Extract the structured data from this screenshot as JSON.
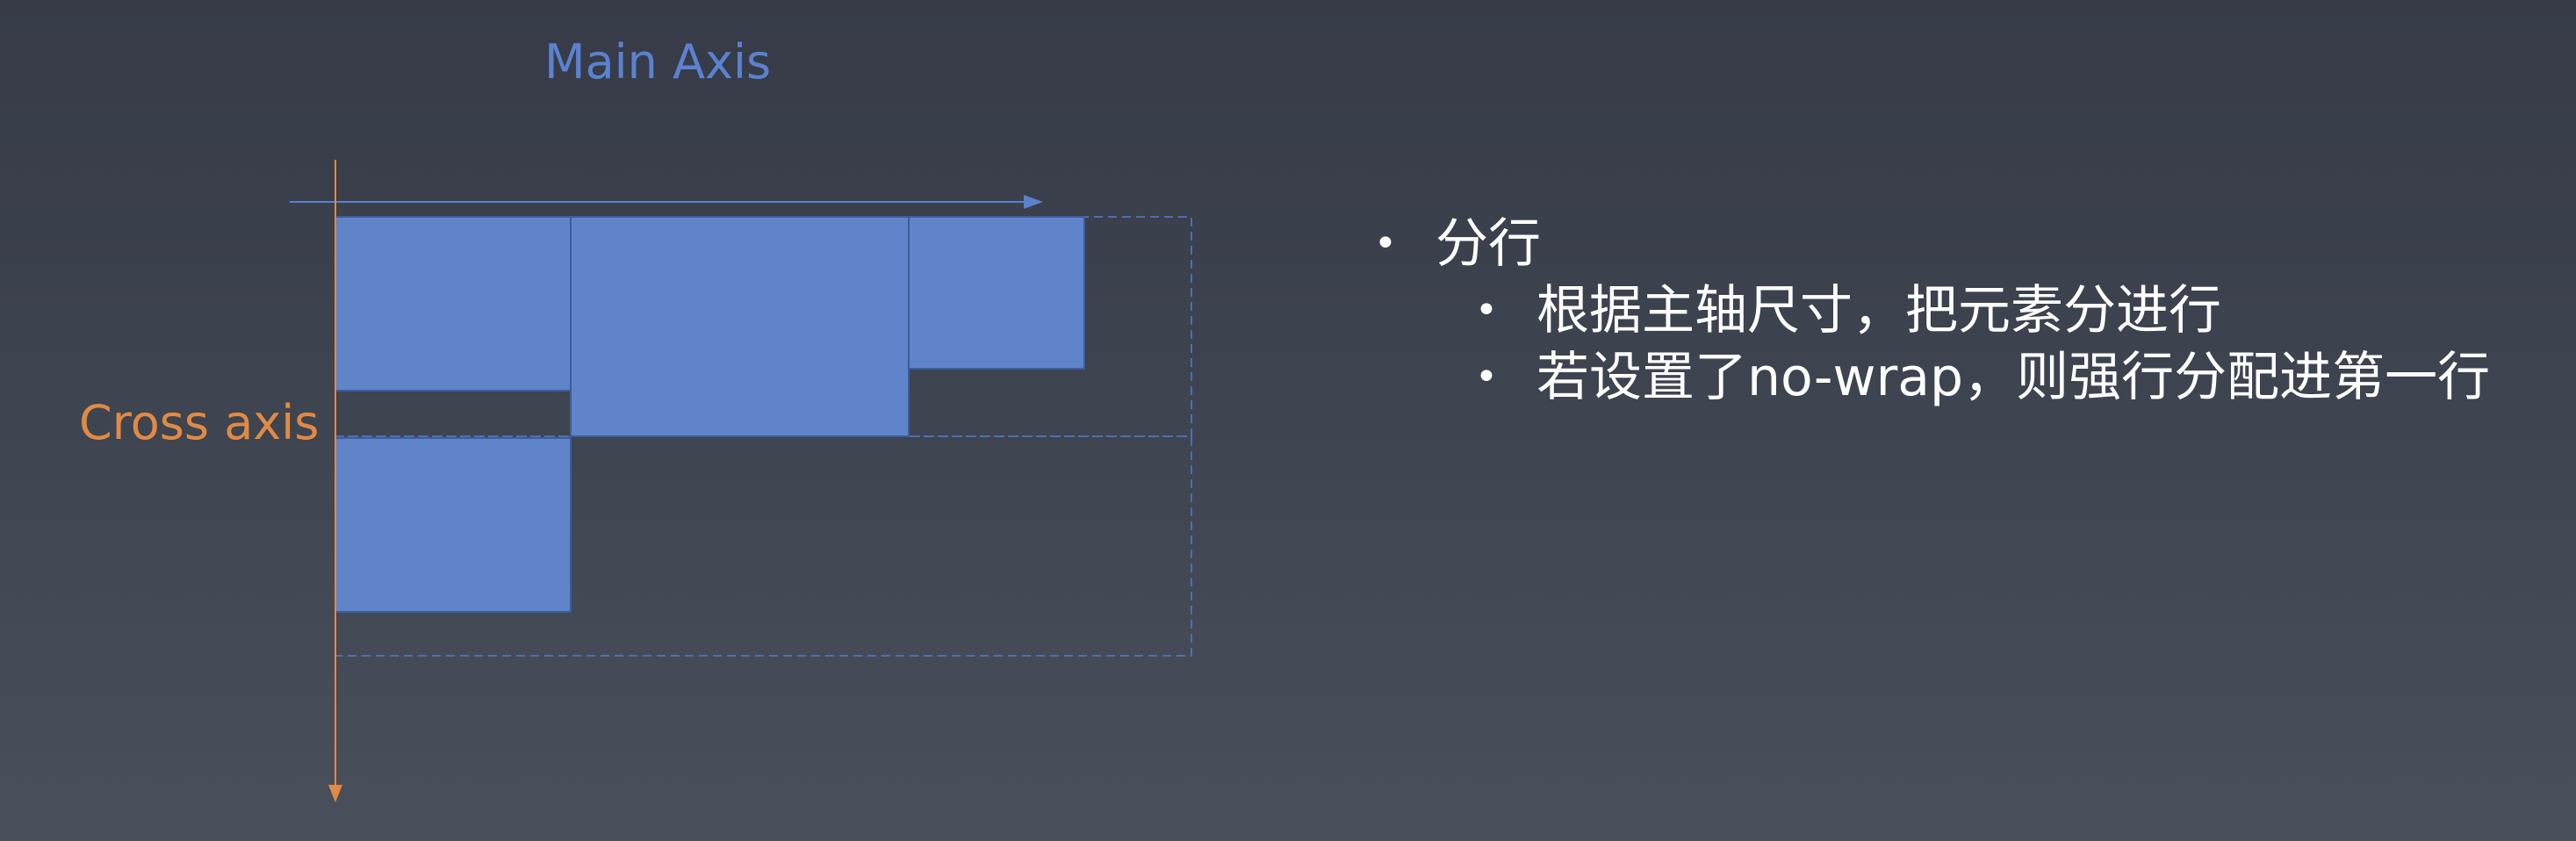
{
  "diagram": {
    "main_axis_label": "Main Axis",
    "cross_axis_label": "Cross axis",
    "colors": {
      "main_axis": "#5a82cf",
      "cross_axis": "#e08a45",
      "item_fill": "#5f84c9",
      "item_border": "#3d5d9c",
      "line_outline": "#4d6fb2"
    }
  },
  "bullets": {
    "item1": "分行",
    "sub1": "根据主轴尺寸，把元素分进行",
    "sub2": "若设置了no-wrap，则强行分配进第一行"
  }
}
